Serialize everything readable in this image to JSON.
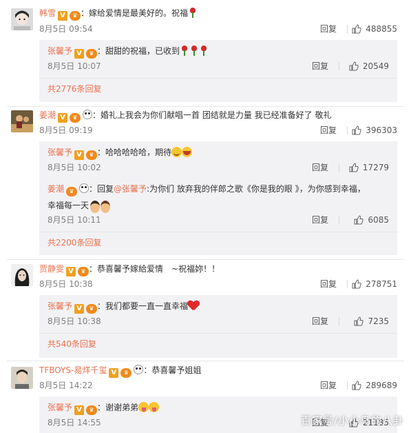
{
  "comments": [
    {
      "user": "韩雪",
      "badges": [
        "v-icon",
        "fan-icon"
      ],
      "text": "：嫁给爱情是最美好的。祝福",
      "emoji": [
        "rose"
      ],
      "time": "8月5日 09:54",
      "reply_label": "回复",
      "likes": "488855",
      "replies": [
        {
          "user": "张馨予",
          "text": "：甜甜的祝福，已收到",
          "emoji": [
            "rose",
            "rose",
            "rose"
          ],
          "time": "8月5日 10:07",
          "reply_label": "回复",
          "likes": "20549"
        }
      ],
      "more": "共2776条回复"
    },
    {
      "user": "姜潮",
      "text": "：婚礼上我会为你们献唱一首 团结就是力量 我已经准备好了 敬礼",
      "time": "8月5日 09:19",
      "reply_label": "回复",
      "likes": "396303",
      "replies": [
        {
          "user": "张馨予",
          "text": "：哈哈哈哈哈，期待",
          "time": "8月5日 10:02",
          "reply_label": "回复",
          "likes": "17279"
        },
        {
          "user": "姜潮",
          "text": "：回复",
          "mention": "@张馨予",
          "text2": ":为你们 放弃我的伴郎之歌《你是我的眼 》，为你感到幸福，",
          "text3": "幸福每一天",
          "time": "8月5日 10:11",
          "reply_label": "回复",
          "likes": "6085"
        }
      ],
      "more": "共2200条回复"
    },
    {
      "user": "贾静雯",
      "text": "：恭喜馨予嫁給爱情　~祝福妳！！",
      "time": "8月5日 10:38",
      "reply_label": "回复",
      "likes": "278751",
      "replies": [
        {
          "user": "张馨予",
          "text": "：我们都要一直一直幸福",
          "time": "8月5日 10:38",
          "reply_label": "回复",
          "likes": "7235"
        }
      ],
      "more": "共540条回复"
    },
    {
      "user": "TFBOYS-易烊千玺",
      "text": "：恭喜馨予姐姐",
      "time": "8月5日 14:22",
      "reply_label": "回复",
      "likes": "289689",
      "replies": [
        {
          "user": "张馨予",
          "text": "：谢谢弟弟",
          "time": "8月5日 14:55",
          "reply_label": "回复",
          "likes": "21185"
        }
      ]
    }
  ],
  "watermark": "百家号/小小鸟的八卦",
  "colors": {
    "username": "#eb7350",
    "subbg": "#f2f2f5",
    "meta": "#808080"
  }
}
